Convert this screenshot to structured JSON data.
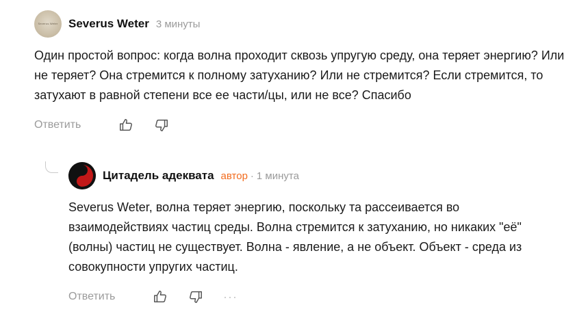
{
  "comments": [
    {
      "author": "Severus Weter",
      "avatar_text": "Severus Weter",
      "time": "3 минуты",
      "text": "Один простой вопрос: когда волна проходит сквозь упругую среду, она теряет энергию? Или не теряет? Она стремится к полному затуханию? Или не стремится? Если стремится, то затухают в равной степени все ее части/цы, или не все? Спасибо",
      "reply_label": "Ответить"
    },
    {
      "author": "Цитадель адеквата",
      "badge": "автор",
      "separator": "·",
      "time": "1 минута",
      "text": "Severus Weter, волна теряет энергию, поскольку та рассеивается во взаимодействиях частиц среды. Волна стремится к затуханию, но никаких \"её\" (волны) частиц не существует. Волна - явление, а не объект. Объект - среда из совокупности упругих частиц.",
      "reply_label": "Ответить",
      "more_label": "···"
    }
  ],
  "icons": {
    "like": "thumb-up-icon",
    "dislike": "thumb-down-icon",
    "avatar2": "yin-yang-icon"
  },
  "colors": {
    "author_badge": "#f26b1d",
    "muted_text": "#9a9a9a",
    "body_text": "#1a1a1a"
  }
}
